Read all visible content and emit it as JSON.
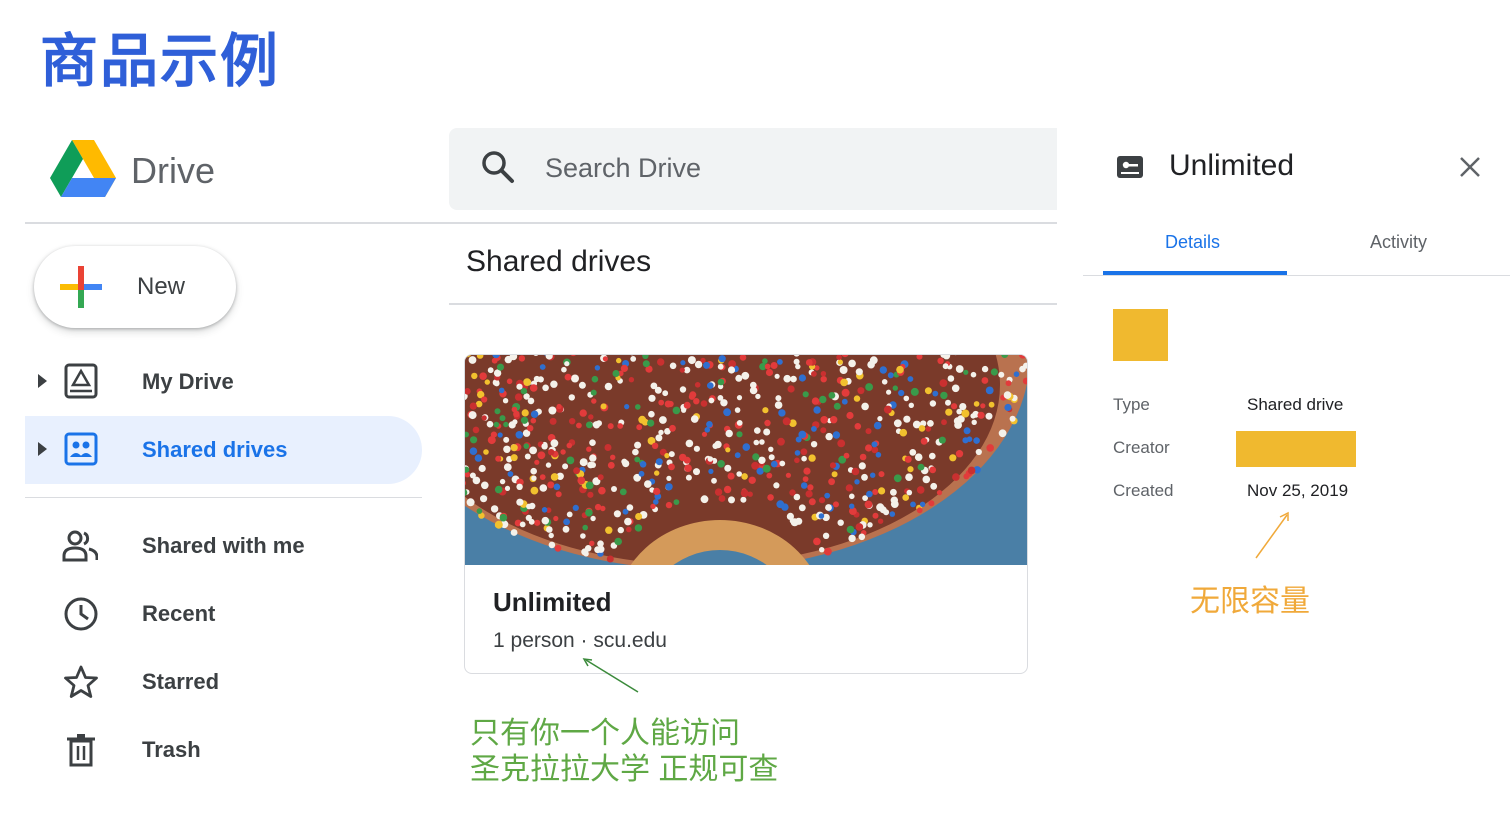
{
  "banner": {
    "title": "商品示例"
  },
  "app": {
    "name": "Drive"
  },
  "search": {
    "placeholder": "Search Drive"
  },
  "new_button": {
    "label": "New"
  },
  "sidebar": {
    "items": [
      {
        "label": "My Drive",
        "icon": "my-drive-icon",
        "active": false,
        "expandable": true
      },
      {
        "label": "Shared drives",
        "icon": "shared-drives-icon",
        "active": true,
        "expandable": true
      },
      {
        "label": "Shared with me",
        "icon": "people-icon",
        "active": false,
        "expandable": false
      },
      {
        "label": "Recent",
        "icon": "clock-icon",
        "active": false,
        "expandable": false
      },
      {
        "label": "Starred",
        "icon": "star-icon",
        "active": false,
        "expandable": false
      },
      {
        "label": "Trash",
        "icon": "trash-icon",
        "active": false,
        "expandable": false
      }
    ]
  },
  "main": {
    "heading": "Shared drives",
    "card": {
      "title": "Unlimited",
      "subtitle": "1 person · scu.edu"
    }
  },
  "annotations": {
    "green_line1": "只有你一个人能访问",
    "green_line2": "圣克拉拉大学 正规可查",
    "orange": "无限容量"
  },
  "details_panel": {
    "title": "Unlimited",
    "tabs": {
      "details": "Details",
      "activity": "Activity"
    },
    "type_label": "Type",
    "type_value": "Shared drive",
    "creator_label": "Creator",
    "created_label": "Created",
    "created_value": "Nov 25, 2019"
  },
  "colors": {
    "accent": "#1a73e8",
    "active_bg": "#e8f0fe",
    "swatch": "#f0b92f",
    "annotation_green": "#5fa845",
    "annotation_orange": "#f0a93a",
    "banner_blue": "#2f5fd8"
  }
}
